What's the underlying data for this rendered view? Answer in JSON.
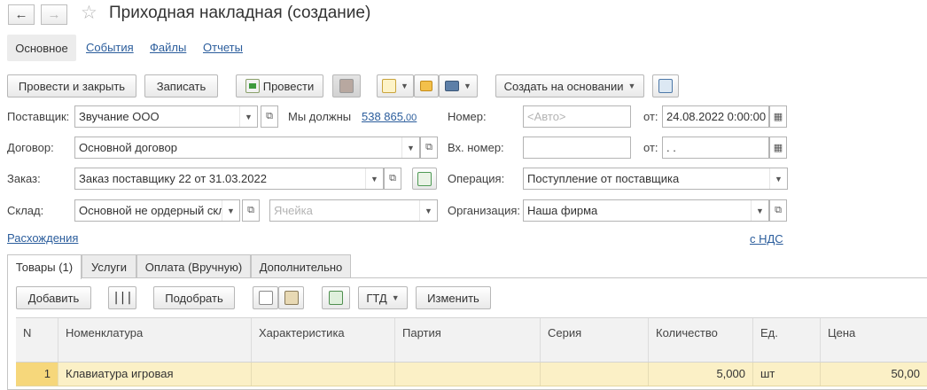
{
  "window": {
    "title": "Приходная накладная (создание)"
  },
  "nav": {
    "back": "←",
    "forward": "→",
    "favorite": "☆"
  },
  "sections": {
    "main": "Основное",
    "links": [
      "События",
      "Файлы",
      "Отчеты"
    ]
  },
  "toolbar": {
    "post_close": "Провести и закрыть",
    "save": "Записать",
    "post": "Провести",
    "create_based": "Создать на основании"
  },
  "form": {
    "supplier": {
      "label": "Поставщик:",
      "value": "Звучание ООО"
    },
    "debt": {
      "label": "Мы должны",
      "amount": "538 865",
      "cents": ",00"
    },
    "number": {
      "label": "Номер:",
      "placeholder": "<Авто>"
    },
    "date": {
      "label": "от:",
      "value": "24.08.2022  0:00:00"
    },
    "contract": {
      "label": "Договор:",
      "value": "Основной договор"
    },
    "in_number": {
      "label": "Вх. номер:",
      "value": ""
    },
    "in_date": {
      "label": "от:",
      "value": " .  ."
    },
    "order": {
      "label": "Заказ:",
      "value": "Заказ поставщику 22 от 31.03.2022"
    },
    "operation": {
      "label": "Операция:",
      "value": "Поступление от поставщика"
    },
    "warehouse": {
      "label": "Склад:",
      "value": "Основной не ордерный скл"
    },
    "cell": {
      "placeholder": "Ячейка"
    },
    "organization": {
      "label": "Организация:",
      "value": "Наша фирма"
    },
    "discrepancies": "Расхождения",
    "vat": "с НДС"
  },
  "tabs": [
    "Товары (1)",
    "Услуги",
    "Оплата (Вручную)",
    "Дополнительно"
  ],
  "table_toolbar": {
    "add": "Добавить",
    "pick": "Подобрать",
    "gtd": "ГТД",
    "change": "Изменить"
  },
  "table": {
    "columns": [
      "N",
      "Номенклатура",
      "Характеристика",
      "Партия",
      "Серия",
      "Количество",
      "Ед.",
      "Цена"
    ],
    "rows": [
      {
        "n": "1",
        "item": "Клавиатура игровая",
        "char": "",
        "batch": "",
        "series": "",
        "qty": "5,000",
        "unit": "шт",
        "price": "50,00"
      }
    ]
  },
  "colors": {
    "accent_link": "#2b5d9c",
    "selected_row": "#fbf0c6",
    "selected_cell": "#f6d77b"
  }
}
